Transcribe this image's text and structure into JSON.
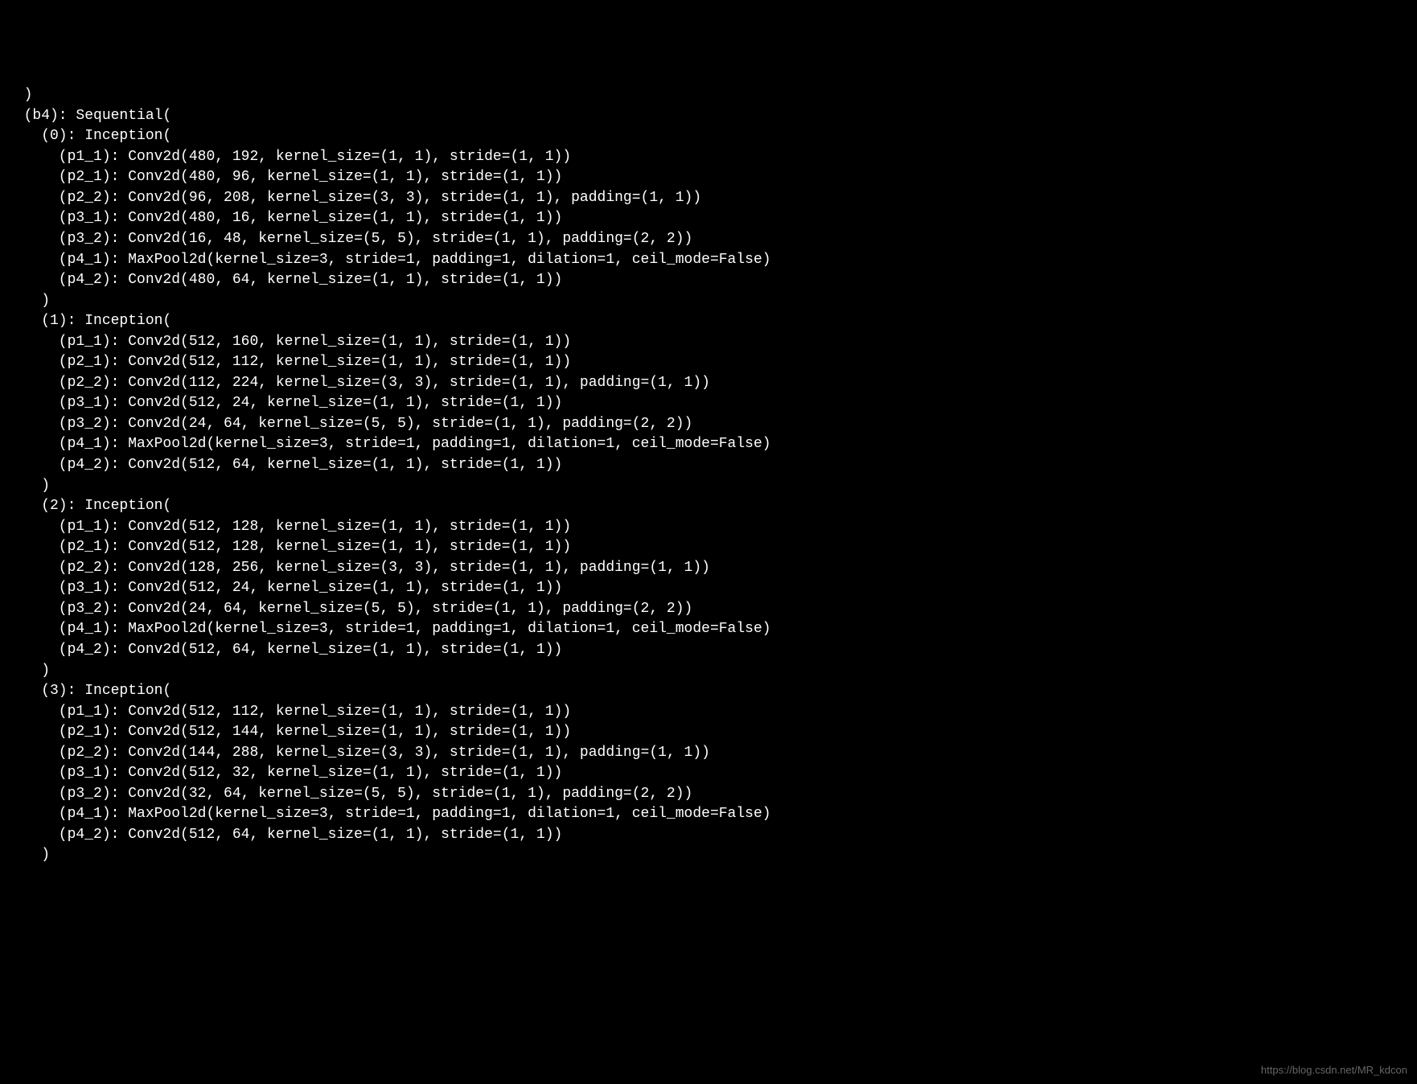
{
  "terminal": {
    "lines": [
      "  )",
      "  (b4): Sequential(",
      "    (0): Inception(",
      "      (p1_1): Conv2d(480, 192, kernel_size=(1, 1), stride=(1, 1))",
      "      (p2_1): Conv2d(480, 96, kernel_size=(1, 1), stride=(1, 1))",
      "      (p2_2): Conv2d(96, 208, kernel_size=(3, 3), stride=(1, 1), padding=(1, 1))",
      "      (p3_1): Conv2d(480, 16, kernel_size=(1, 1), stride=(1, 1))",
      "      (p3_2): Conv2d(16, 48, kernel_size=(5, 5), stride=(1, 1), padding=(2, 2))",
      "      (p4_1): MaxPool2d(kernel_size=3, stride=1, padding=1, dilation=1, ceil_mode=False)",
      "      (p4_2): Conv2d(480, 64, kernel_size=(1, 1), stride=(1, 1))",
      "    )",
      "    (1): Inception(",
      "      (p1_1): Conv2d(512, 160, kernel_size=(1, 1), stride=(1, 1))",
      "      (p2_1): Conv2d(512, 112, kernel_size=(1, 1), stride=(1, 1))",
      "      (p2_2): Conv2d(112, 224, kernel_size=(3, 3), stride=(1, 1), padding=(1, 1))",
      "      (p3_1): Conv2d(512, 24, kernel_size=(1, 1), stride=(1, 1))",
      "      (p3_2): Conv2d(24, 64, kernel_size=(5, 5), stride=(1, 1), padding=(2, 2))",
      "      (p4_1): MaxPool2d(kernel_size=3, stride=1, padding=1, dilation=1, ceil_mode=False)",
      "      (p4_2): Conv2d(512, 64, kernel_size=(1, 1), stride=(1, 1))",
      "    )",
      "    (2): Inception(",
      "      (p1_1): Conv2d(512, 128, kernel_size=(1, 1), stride=(1, 1))",
      "      (p2_1): Conv2d(512, 128, kernel_size=(1, 1), stride=(1, 1))",
      "      (p2_2): Conv2d(128, 256, kernel_size=(3, 3), stride=(1, 1), padding=(1, 1))",
      "      (p3_1): Conv2d(512, 24, kernel_size=(1, 1), stride=(1, 1))",
      "      (p3_2): Conv2d(24, 64, kernel_size=(5, 5), stride=(1, 1), padding=(2, 2))",
      "      (p4_1): MaxPool2d(kernel_size=3, stride=1, padding=1, dilation=1, ceil_mode=False)",
      "      (p4_2): Conv2d(512, 64, kernel_size=(1, 1), stride=(1, 1))",
      "    )",
      "    (3): Inception(",
      "      (p1_1): Conv2d(512, 112, kernel_size=(1, 1), stride=(1, 1))",
      "      (p2_1): Conv2d(512, 144, kernel_size=(1, 1), stride=(1, 1))",
      "      (p2_2): Conv2d(144, 288, kernel_size=(3, 3), stride=(1, 1), padding=(1, 1))",
      "      (p3_1): Conv2d(512, 32, kernel_size=(1, 1), stride=(1, 1))",
      "      (p3_2): Conv2d(32, 64, kernel_size=(5, 5), stride=(1, 1), padding=(2, 2))",
      "      (p4_1): MaxPool2d(kernel_size=3, stride=1, padding=1, dilation=1, ceil_mode=False)",
      "      (p4_2): Conv2d(512, 64, kernel_size=(1, 1), stride=(1, 1))",
      "    )"
    ]
  },
  "watermark": {
    "text": "https://blog.csdn.net/MR_kdcon"
  }
}
